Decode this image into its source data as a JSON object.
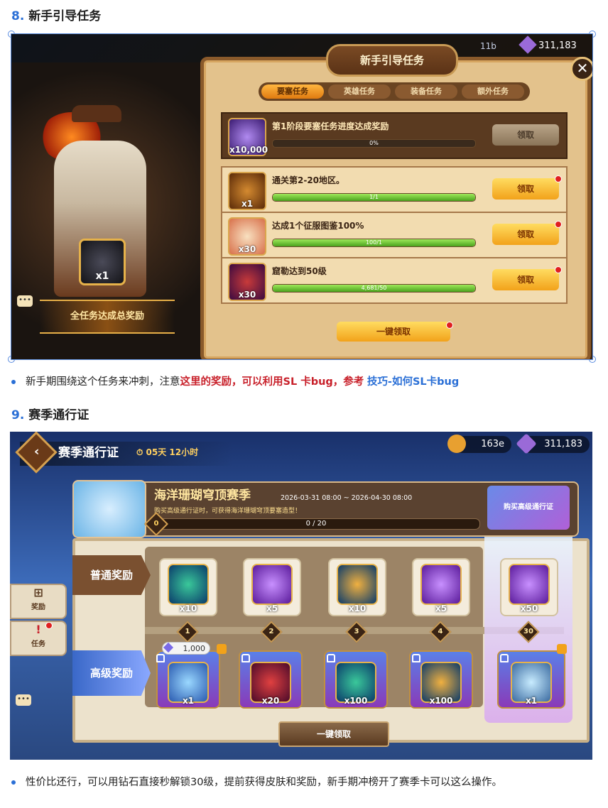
{
  "section8": {
    "num": "8.",
    "title": "新手引导任务",
    "screenshot": {
      "panel_title": "新手引导任务",
      "close": "✕",
      "tabs": [
        "要塞任务",
        "英雄任务",
        "装备任务",
        "额外任务"
      ],
      "active_tab": "要塞任务",
      "stage_reward": {
        "count": "x10,000",
        "title": "第1阶段要塞任务进度达成奖励",
        "progress_text": "0%",
        "progress": 0,
        "button": "领取"
      },
      "tasks": [
        {
          "count": "x1",
          "title": "通关第2-20地区。",
          "progress_text": "1/1",
          "progress": 1,
          "button": "领取"
        },
        {
          "count": "x30",
          "title": "达成1个征服图鉴100%",
          "progress_text": "100/1",
          "progress": 1,
          "button": "领取"
        },
        {
          "count": "x30",
          "title": "窟勒达到50级",
          "progress_text": "4,681/50",
          "progress": 1,
          "button": "领取"
        }
      ],
      "claim_all": "一键领取",
      "all_reward_label": "全任务达成总奖励",
      "all_reward_count": "x1",
      "top_currency": "311,183",
      "top_small": "11b"
    },
    "note_prefix": "新手期围绕这个任务来冲刺，注意",
    "note_red": "这里的奖励，可以利用SL 卡bug，参考",
    "note_link": "技巧-如何SL卡bug"
  },
  "section9": {
    "num": "9.",
    "title": "赛季通行证",
    "screenshot": {
      "title": "赛季通行证",
      "timer": "05天 12小时",
      "currency_a": "163e",
      "currency_b": "311,183",
      "season_name": "海洋珊瑚穹顶赛季",
      "season_dates": "2026-03-31 08:00 ~ 2026-04-30 08:00",
      "season_sub": "购买高级通行证时，可获得海洋珊瑚穹顶要塞造型！",
      "season_progress": "0 / 20",
      "season_level_start": "0",
      "buy_button": "购买高级通行证",
      "free_label": "普通奖励",
      "premium_label": "高级奖励",
      "side_reward": "奖励",
      "side_task": "任务",
      "levels": [
        "1",
        "2",
        "3",
        "4",
        "30"
      ],
      "free_counts": [
        "x10",
        "x5",
        "x10",
        "x5",
        "x50"
      ],
      "premium_counts": [
        "x1",
        "x20",
        "x100",
        "x100",
        "x1"
      ],
      "diamond_cost": "1,000",
      "claim_all": "一键领取"
    },
    "note": "性价比还行，可以用钻石直接秒解锁30级，提前获得皮肤和奖励，新手期冲榜开了赛季卡可以这么操作。"
  },
  "colors": {
    "accent_blue": "#2a6fd6",
    "accent_red": "#c8202a",
    "gold_button": "#f2a21a"
  }
}
